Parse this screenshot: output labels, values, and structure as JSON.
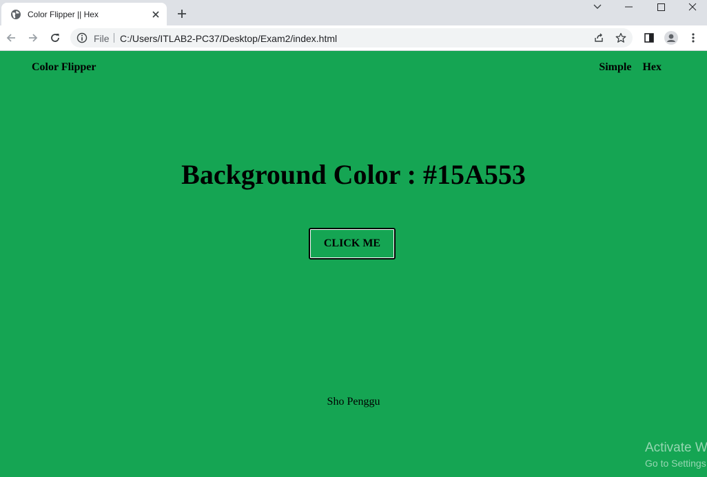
{
  "browser": {
    "tab": {
      "title": "Color Flipper || Hex"
    },
    "omnibox": {
      "scheme_label": "File",
      "url": "C:/Users/ITLAB2-PC37/Desktop/Exam2/index.html"
    }
  },
  "page": {
    "background_color": "#15A553",
    "nav": {
      "brand": "Color Flipper",
      "links": [
        "Simple",
        "Hex"
      ]
    },
    "heading": "Background Color : #15A553",
    "button_label": "CLICK ME",
    "author": "Sho Penggu"
  },
  "watermark": {
    "line1": "Activate Windows",
    "line2": "Go to Settings to activate Windows."
  }
}
